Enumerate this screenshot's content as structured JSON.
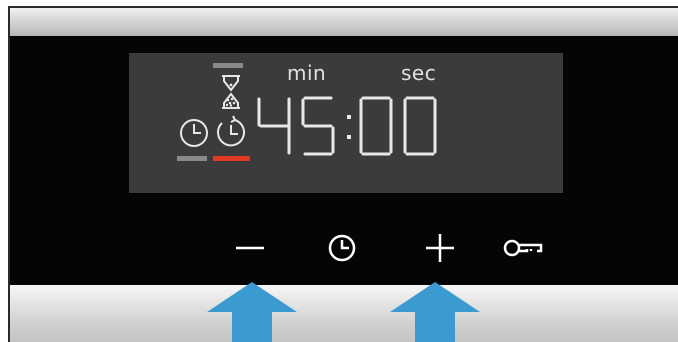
{
  "display": {
    "min_label": "min",
    "sec_label": "sec",
    "minutes": "45",
    "seconds": "00",
    "separator": ":",
    "active_function": "timer-with-clock-icon",
    "active_indicator_color": "#e03a24",
    "segment_color": "#e8e8e8"
  },
  "controls": [
    {
      "name": "minus",
      "icon": "minus-icon"
    },
    {
      "name": "clock",
      "icon": "clock-icon"
    },
    {
      "name": "plus",
      "icon": "plus-icon"
    },
    {
      "name": "key",
      "icon": "key-icon"
    }
  ],
  "callouts": {
    "arrow_color": "#3b9bd1",
    "targets": [
      "minus",
      "plus"
    ]
  }
}
